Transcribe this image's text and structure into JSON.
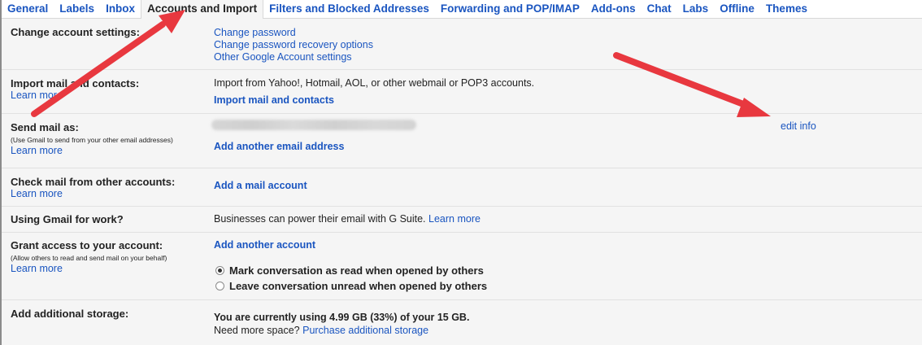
{
  "tabs": [
    "General",
    "Labels",
    "Inbox",
    "Accounts and Import",
    "Filters and Blocked Addresses",
    "Forwarding and POP/IMAP",
    "Add-ons",
    "Chat",
    "Labs",
    "Offline",
    "Themes"
  ],
  "active_tab": "Accounts and Import",
  "sections": {
    "change_account": {
      "label": "Change account settings:",
      "links": [
        "Change password",
        "Change password recovery options",
        "Other Google Account settings"
      ]
    },
    "import": {
      "label": "Import mail and contacts:",
      "learn_more": "Learn more",
      "description": "Import from Yahoo!, Hotmail, AOL, or other webmail or POP3 accounts.",
      "action": "Import mail and contacts"
    },
    "send_as": {
      "label": "Send mail as:",
      "sublabel": "(Use Gmail to send from your other email addresses)",
      "learn_more": "Learn more",
      "edit": "edit info",
      "action": "Add another email address"
    },
    "check_mail": {
      "label": "Check mail from other accounts:",
      "learn_more": "Learn more",
      "action": "Add a mail account"
    },
    "gmail_work": {
      "label": "Using Gmail for work?",
      "text": "Businesses can power their email with G Suite.",
      "link": "Learn more"
    },
    "grant_access": {
      "label": "Grant access to your account:",
      "sublabel": "(Allow others to read and send mail on your behalf)",
      "learn_more": "Learn more",
      "action": "Add another account",
      "options": [
        "Mark conversation as read when opened by others",
        "Leave conversation unread when opened by others"
      ],
      "selected_option": 0
    },
    "storage": {
      "label": "Add additional storage:",
      "usage": "You are currently using 4.99 GB (33%) of your 15 GB.",
      "question": "Need more space?",
      "link": "Purchase additional storage"
    }
  },
  "colors": {
    "link": "#1a55c0",
    "arrow": "#e8383f",
    "background": "#f5f5f5"
  },
  "annotations": [
    "red-arrow-to-accounts-tab",
    "red-arrow-to-edit-info"
  ]
}
